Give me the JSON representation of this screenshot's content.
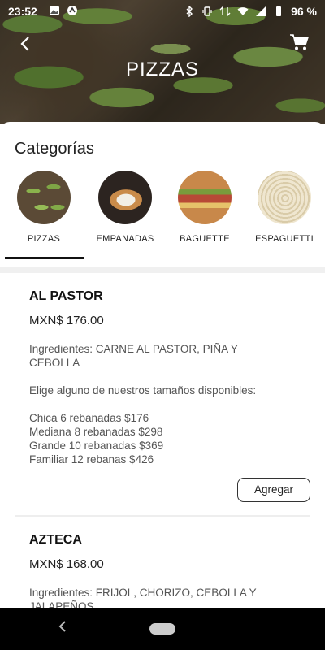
{
  "status_bar": {
    "time": "23:52",
    "battery": "96 %"
  },
  "header": {
    "title": "PIZZAS"
  },
  "categories": {
    "title": "Categorías",
    "items": [
      {
        "label": "PIZZAS"
      },
      {
        "label": "EMPANADAS"
      },
      {
        "label": "BAGUETTE"
      },
      {
        "label": "ESPAGUETTI"
      }
    ],
    "selected": "PIZZAS"
  },
  "products": [
    {
      "name": "AL PASTOR",
      "price": "MXN$ 176.00",
      "ingredients": "Ingredientes: CARNE AL PASTOR, PIÑA Y CEBOLLA",
      "sizes_intro": "Elige alguno de nuestros tamaños disponibles:",
      "sizes": [
        "Chica 6 rebanadas $176",
        "Mediana 8 rebanadas $298",
        "Grande 10 rebanadas $369",
        "Familiar 12 rebanas $426"
      ],
      "button": "Agregar"
    },
    {
      "name": "AZTECA",
      "price": "MXN$ 168.00",
      "ingredients": "Ingredientes: FRIJOL, CHORIZO, CEBOLLA Y JALAPEÑOS"
    }
  ],
  "colors": {
    "accent": "#111111",
    "divider": "#eeeeee"
  }
}
